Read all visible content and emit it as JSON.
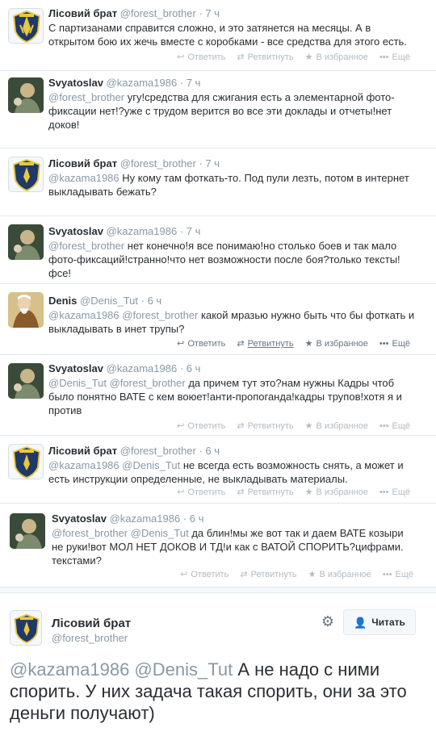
{
  "actions": {
    "reply": "Ответить",
    "retweet": "Ретвитнуть",
    "favorite": "В избранное",
    "more": "Ещё"
  },
  "tweets": [
    {
      "fullname": "Лісовий брат",
      "username": "@forest_brother",
      "time": "7 ч",
      "mention": "",
      "text": "С партизанами справится сложно, и это затянется на месяцы. А в открытом бою их жечь вместе с коробками - все средства для этого есть."
    },
    {
      "fullname": "Svyatoslav",
      "username": "@kazama1986",
      "time": "7 ч",
      "mention": "@forest_brother",
      "text": "угу!средства для сжигания есть а элементарной фото-фиксации нет!?уже с трудом верится во все эти доклады и отчеты!нет доков!"
    },
    {
      "fullname": "Лісовий брат",
      "username": "@forest_brother",
      "time": "7 ч",
      "mention": "@kazama1986",
      "text": "Ну кому там фоткать-то. Под пули лезть, потом в интернет выкладывать бежать?"
    },
    {
      "fullname": "Svyatoslav",
      "username": "@kazama1986",
      "time": "7 ч",
      "mention": "@forest_brother",
      "text": "нет конечно!я все понимаю!но столько боев и так мало фото-фиксаций!странно!что нет возможности после боя?только тексты!фсе!"
    },
    {
      "fullname": "Denis",
      "username": "@Denis_Tut",
      "time": "6 ч",
      "mention": "@kazama1986 @forest_brother",
      "text": "какой мразью нужно быть что бы фоткать и выкладывать в инет трупы?"
    },
    {
      "fullname": "Svyatoslav",
      "username": "@kazama1986",
      "time": "6 ч",
      "mention": "@Denis_Tut @forest_brother",
      "text": "да причем тут это?нам нужны Кадры чтоб было понятно ВАТЕ с кем воюет!анти-пропоганда!кадры трупов!хотя я и против"
    },
    {
      "fullname": "Лісовий брат",
      "username": "@forest_brother",
      "time": "6 ч",
      "mention": "@kazama1986 @Denis_Tut",
      "text": "не всегда есть возможность снять, а может и есть инструкции определенные, не выкладывать материалы."
    },
    {
      "fullname": "Svyatoslav",
      "username": "@kazama1986",
      "time": "6 ч",
      "mention": "@forest_brother @Denis_Tut",
      "text": "да блин!мы же вот так и даем ВАТЕ козыри не руки!вот МОЛ НЕТ ДОКОВ И ТД!и как с ВАТОЙ СПОРИТЬ?цифрами. текстами?"
    }
  ],
  "detail": {
    "fullname": "Лісовий брат",
    "username": "@forest_brother",
    "follow_label": "Читать",
    "mention": "@kazama1986 @Denis_Tut",
    "text": "А не надо с ними спорить. У них задача такая спорить, они за это деньги получают)"
  }
}
